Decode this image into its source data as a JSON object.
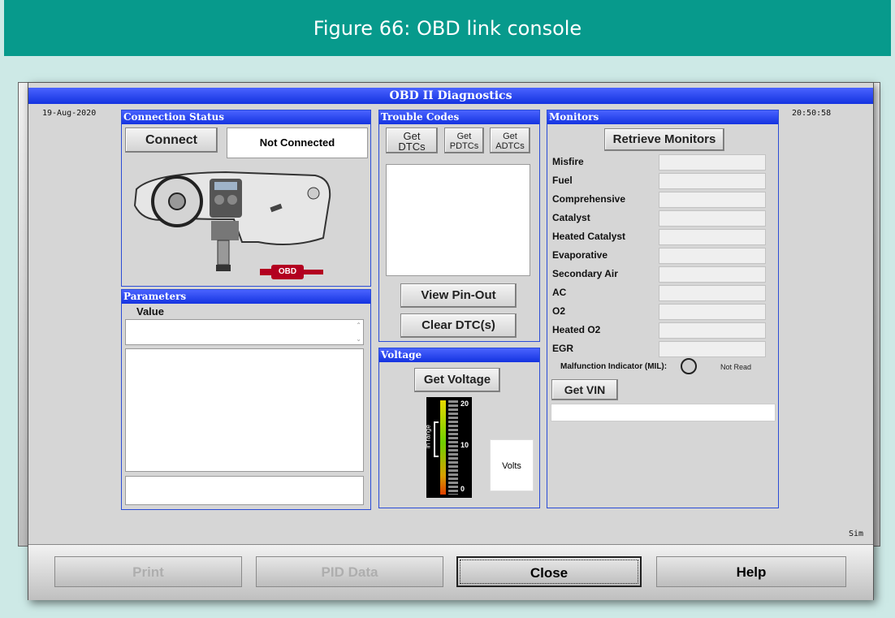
{
  "figure": {
    "caption": "Figure 66: OBD link console"
  },
  "window": {
    "title": "OBD II Diagnostics",
    "date": "19-Aug-2020",
    "time": "20:50:58",
    "mode": "Sim"
  },
  "connection": {
    "heading": "Connection Status",
    "connect_button": "Connect",
    "status": "Not Connected",
    "plug_label": "OBD"
  },
  "parameters": {
    "heading": "Parameters",
    "value_label": "Value"
  },
  "trouble_codes": {
    "heading": "Trouble Codes",
    "get_dtcs": "Get\nDTCs",
    "get_pdtcs": "Get\nPDTCs",
    "get_adtcs": "Get\nADTCs",
    "view_pinout": "View Pin-Out",
    "clear_dtcs": "Clear DTC(s)"
  },
  "voltage": {
    "heading": "Voltage",
    "get_voltage": "Get Voltage",
    "scale_top": "20",
    "scale_mid": "10",
    "scale_bottom": "0",
    "in_range": "in range",
    "units": "Volts"
  },
  "monitors": {
    "heading": "Monitors",
    "retrieve": "Retrieve Monitors",
    "items": [
      {
        "label": "Misfire"
      },
      {
        "label": "Fuel"
      },
      {
        "label": "Comprehensive"
      },
      {
        "label": "Catalyst"
      },
      {
        "label": "Heated Catalyst"
      },
      {
        "label": "Evaporative"
      },
      {
        "label": "Secondary Air"
      },
      {
        "label": "AC"
      },
      {
        "label": "O2"
      },
      {
        "label": "Heated O2"
      },
      {
        "label": "EGR"
      }
    ],
    "mil_label": "Malfunction Indicator (MIL):",
    "mil_status": "Not Read",
    "get_vin": "Get VIN"
  },
  "footer": {
    "print": "Print",
    "pid_data": "PID Data",
    "close": "Close",
    "help": "Help"
  },
  "colors": {
    "teal_header": "#079a8c",
    "title_blue": "#1433e0",
    "background": "#cde9e6"
  }
}
